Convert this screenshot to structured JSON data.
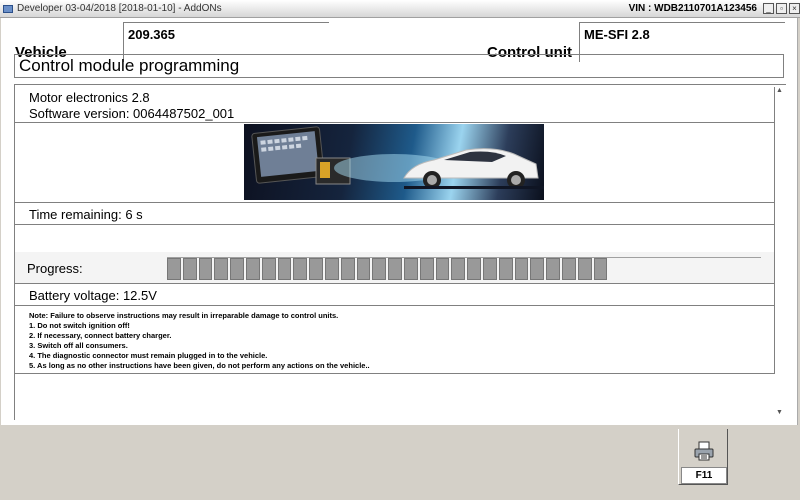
{
  "window": {
    "title": "Developer 03-04/2018 [2018-01-10] - AddONs",
    "vin": "VIN : WDB2110701A123456",
    "buttons": [
      "minimize",
      "restore",
      "close"
    ]
  },
  "header": {
    "vehicle_label": "Vehicle",
    "vehicle_value": "209.365",
    "control_unit_label": "Control unit",
    "control_unit_value": "ME-SFI 2.8"
  },
  "section_title": "Control module programming",
  "module": {
    "name": "Motor electronics 2.8",
    "software_version": "Software version: 0064487502_001"
  },
  "time_remaining": "Time remaining: 6 s",
  "progress": {
    "label": "Progress:",
    "filled_segments": 28,
    "total_segments": 38
  },
  "battery_voltage": "Battery voltage: 12.5V",
  "notes": [
    "Note:  Failure to observe instructions may result in irreparable damage to control units.",
    "1. Do not switch ignition off!",
    "2. If necessary, connect battery charger.",
    "3. Switch off all consumers.",
    "4. The diagnostic connector must remain plugged in to the vehicle.",
    "5. As long as no other instructions have been given, do not perform any actions on the vehicle.."
  ],
  "footer": {
    "print_key": "F11",
    "print_icon": "printer-icon"
  }
}
